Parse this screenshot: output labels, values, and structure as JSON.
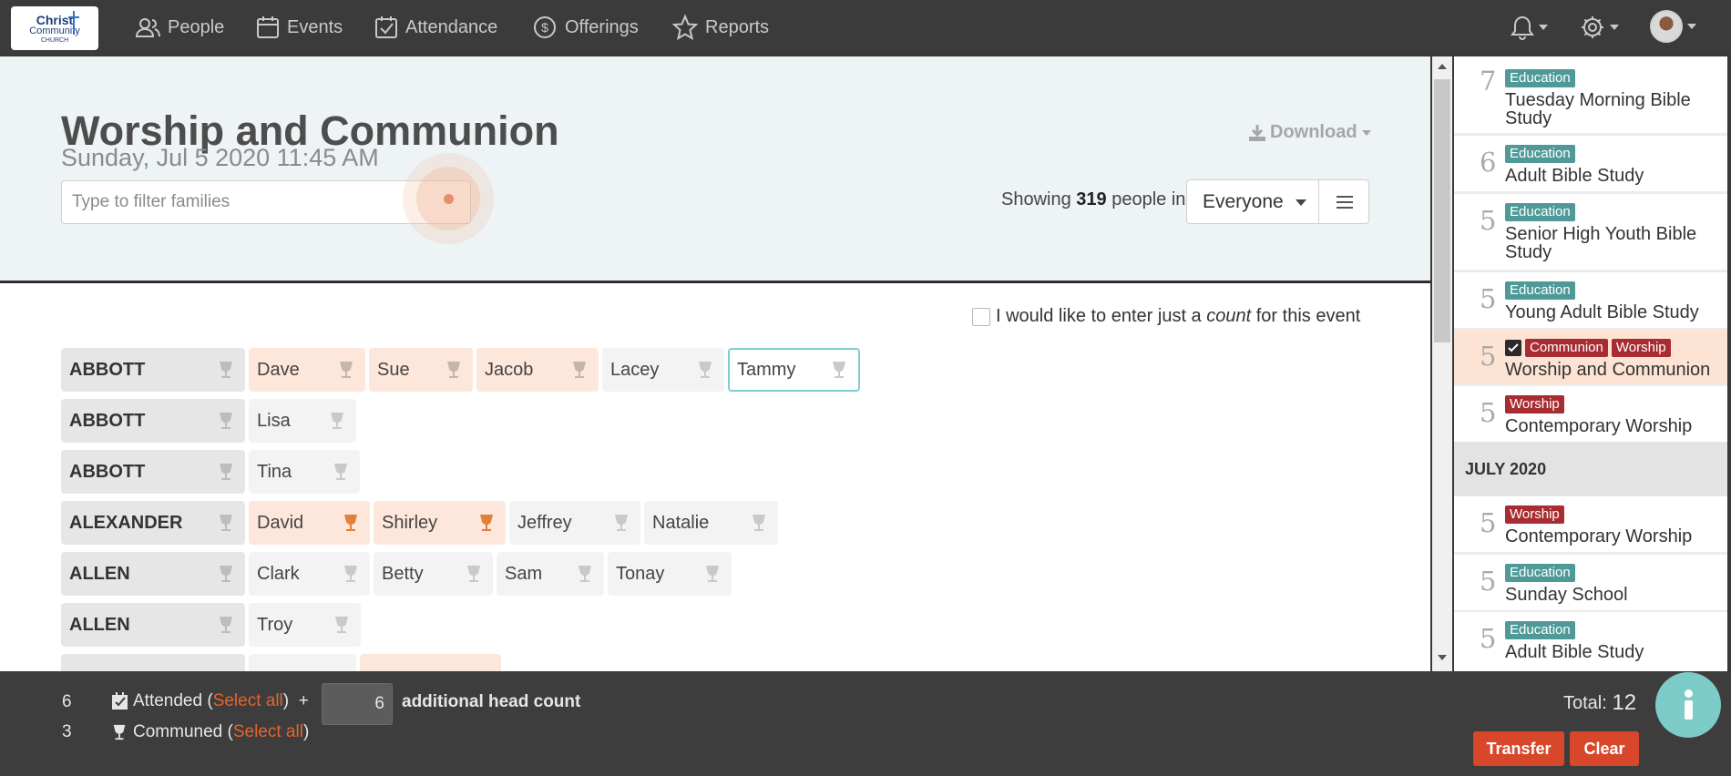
{
  "nav": {
    "logo": {
      "line1": "Christ",
      "line2": "Community",
      "line3": "CHURCH"
    },
    "items": [
      {
        "label": "People",
        "icon": "people-icon"
      },
      {
        "label": "Events",
        "icon": "calendar-icon"
      },
      {
        "label": "Attendance",
        "icon": "attendance-icon"
      },
      {
        "label": "Offerings",
        "icon": "offerings-icon"
      },
      {
        "label": "Reports",
        "icon": "star-icon"
      }
    ],
    "right": [
      "bell-icon",
      "gear-icon",
      "avatar"
    ]
  },
  "event": {
    "title": "Worship and Communion",
    "datetime": "Sunday, Jul 5 2020 11:45 AM",
    "filter_placeholder": "Type to filter families",
    "download_label": "Download",
    "showing_prefix": "Showing",
    "showing_count": "319",
    "showing_suffix": "people in",
    "group_select": "Everyone",
    "count_prefix": "I would like to enter just a",
    "count_em": "count",
    "count_suffix": "for this event"
  },
  "families": [
    {
      "name": "ABBOTT",
      "members": [
        {
          "name": "Dave",
          "state": "attended",
          "communed": false
        },
        {
          "name": "Sue",
          "state": "attended",
          "communed": false
        },
        {
          "name": "Jacob",
          "state": "attended",
          "communed": false
        },
        {
          "name": "Lacey",
          "state": "absent",
          "communed": false
        },
        {
          "name": "Tammy",
          "state": "focused",
          "communed": false
        }
      ]
    },
    {
      "name": "ABBOTT",
      "members": [
        {
          "name": "Lisa",
          "state": "absent",
          "communed": false
        }
      ]
    },
    {
      "name": "ABBOTT",
      "members": [
        {
          "name": "Tina",
          "state": "absent",
          "communed": false
        }
      ]
    },
    {
      "name": "ALEXANDER",
      "members": [
        {
          "name": "David",
          "state": "attended",
          "communed": true
        },
        {
          "name": "Shirley",
          "state": "attended",
          "communed": true
        },
        {
          "name": "Jeffrey",
          "state": "absent",
          "communed": false
        },
        {
          "name": "Natalie",
          "state": "absent",
          "communed": false
        }
      ]
    },
    {
      "name": "ALLEN",
      "members": [
        {
          "name": "Clark",
          "state": "absent",
          "communed": false
        },
        {
          "name": "Betty",
          "state": "absent",
          "communed": false
        },
        {
          "name": "Sam",
          "state": "absent",
          "communed": false
        },
        {
          "name": "Tonay",
          "state": "absent",
          "communed": false
        }
      ]
    },
    {
      "name": "ALLEN",
      "members": [
        {
          "name": "Troy",
          "state": "absent",
          "communed": false
        }
      ]
    }
  ],
  "side_events": [
    {
      "count": "7",
      "tags": [
        "Education"
      ],
      "name": "Tuesday Morning Bible Study",
      "active": false
    },
    {
      "count": "6",
      "tags": [
        "Education"
      ],
      "name": "Adult Bible Study",
      "active": false
    },
    {
      "count": "5",
      "tags": [
        "Education"
      ],
      "name": "Senior High Youth Bible Study",
      "active": false
    },
    {
      "count": "5",
      "tags": [
        "Education"
      ],
      "name": "Young Adult Bible Study",
      "active": false
    },
    {
      "count": "5",
      "tags": [
        "Communion",
        "Worship"
      ],
      "name": "Worship and Communion",
      "active": true,
      "checked": true
    },
    {
      "count": "5",
      "tags": [
        "Worship"
      ],
      "name": "Contemporary Worship",
      "active": false
    }
  ],
  "month_header": "JULY 2020",
  "side_events_july": [
    {
      "count": "5",
      "tags": [
        "Worship"
      ],
      "name": "Contemporary Worship"
    },
    {
      "count": "5",
      "tags": [
        "Education"
      ],
      "name": "Sunday School"
    },
    {
      "count": "5",
      "tags": [
        "Education"
      ],
      "name": "Adult Bible Study"
    }
  ],
  "footer": {
    "attended_count": "6",
    "attended_label": "Attended",
    "select_all": "Select all",
    "plus": "+",
    "headcount_value": "6",
    "headcount_label": "additional head count",
    "communed_count": "3",
    "communed_label": "Communed",
    "total_label": "Total:",
    "total_value": "12",
    "transfer_label": "Transfer",
    "clear_label": "Clear"
  },
  "colors": {
    "accent": "#d9472a",
    "attended_bg": "#fde7da",
    "education_tag": "#4f9a98",
    "worship_tag": "#a72d32",
    "info_button": "#7ccbc8"
  }
}
